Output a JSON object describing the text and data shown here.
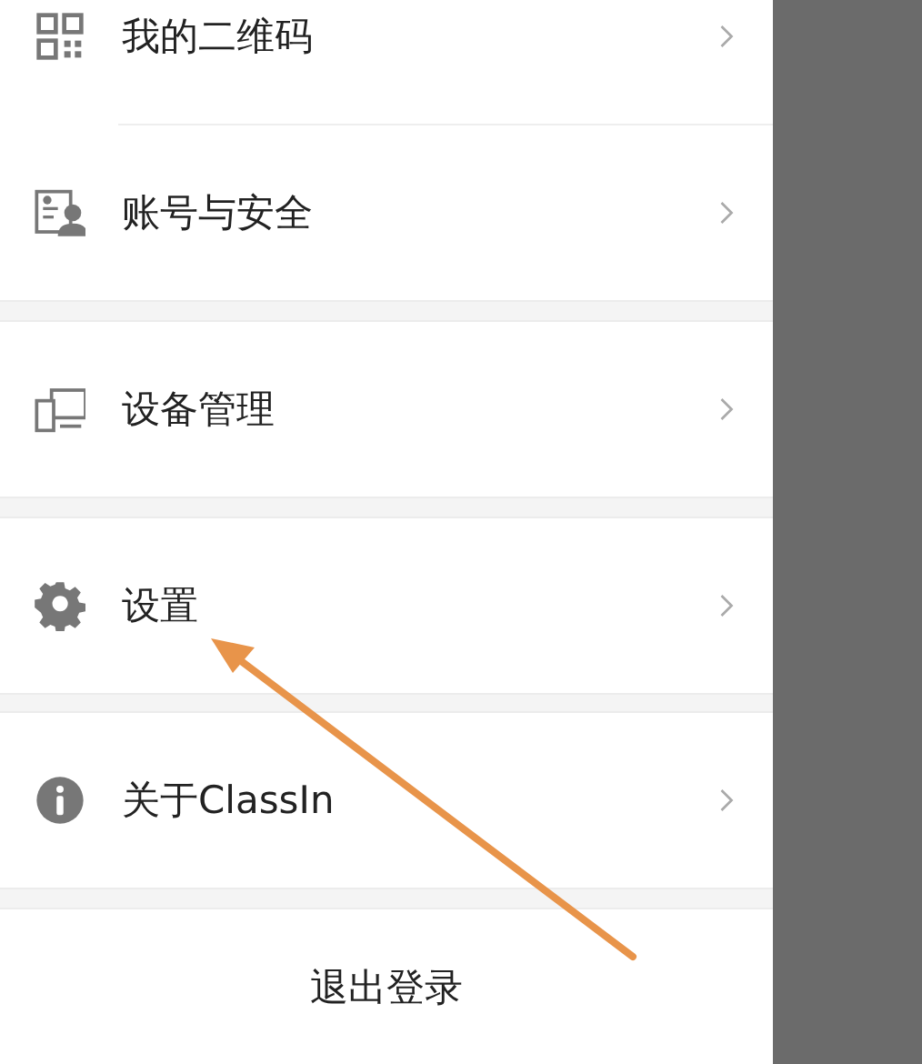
{
  "menu_groups": [
    {
      "items": [
        {
          "kind": "qr",
          "label": "我的二维码"
        },
        {
          "kind": "account",
          "label": "账号与安全"
        }
      ]
    },
    {
      "items": [
        {
          "kind": "devices",
          "label": "设备管理"
        }
      ]
    },
    {
      "items": [
        {
          "kind": "gear",
          "label": "设置"
        }
      ]
    },
    {
      "items": [
        {
          "kind": "info",
          "label": "关于ClassIn"
        }
      ]
    }
  ],
  "logout_button": {
    "label": "退出登录"
  },
  "annotations": [
    {
      "kind": "arrow",
      "color": "#e8944a"
    }
  ]
}
